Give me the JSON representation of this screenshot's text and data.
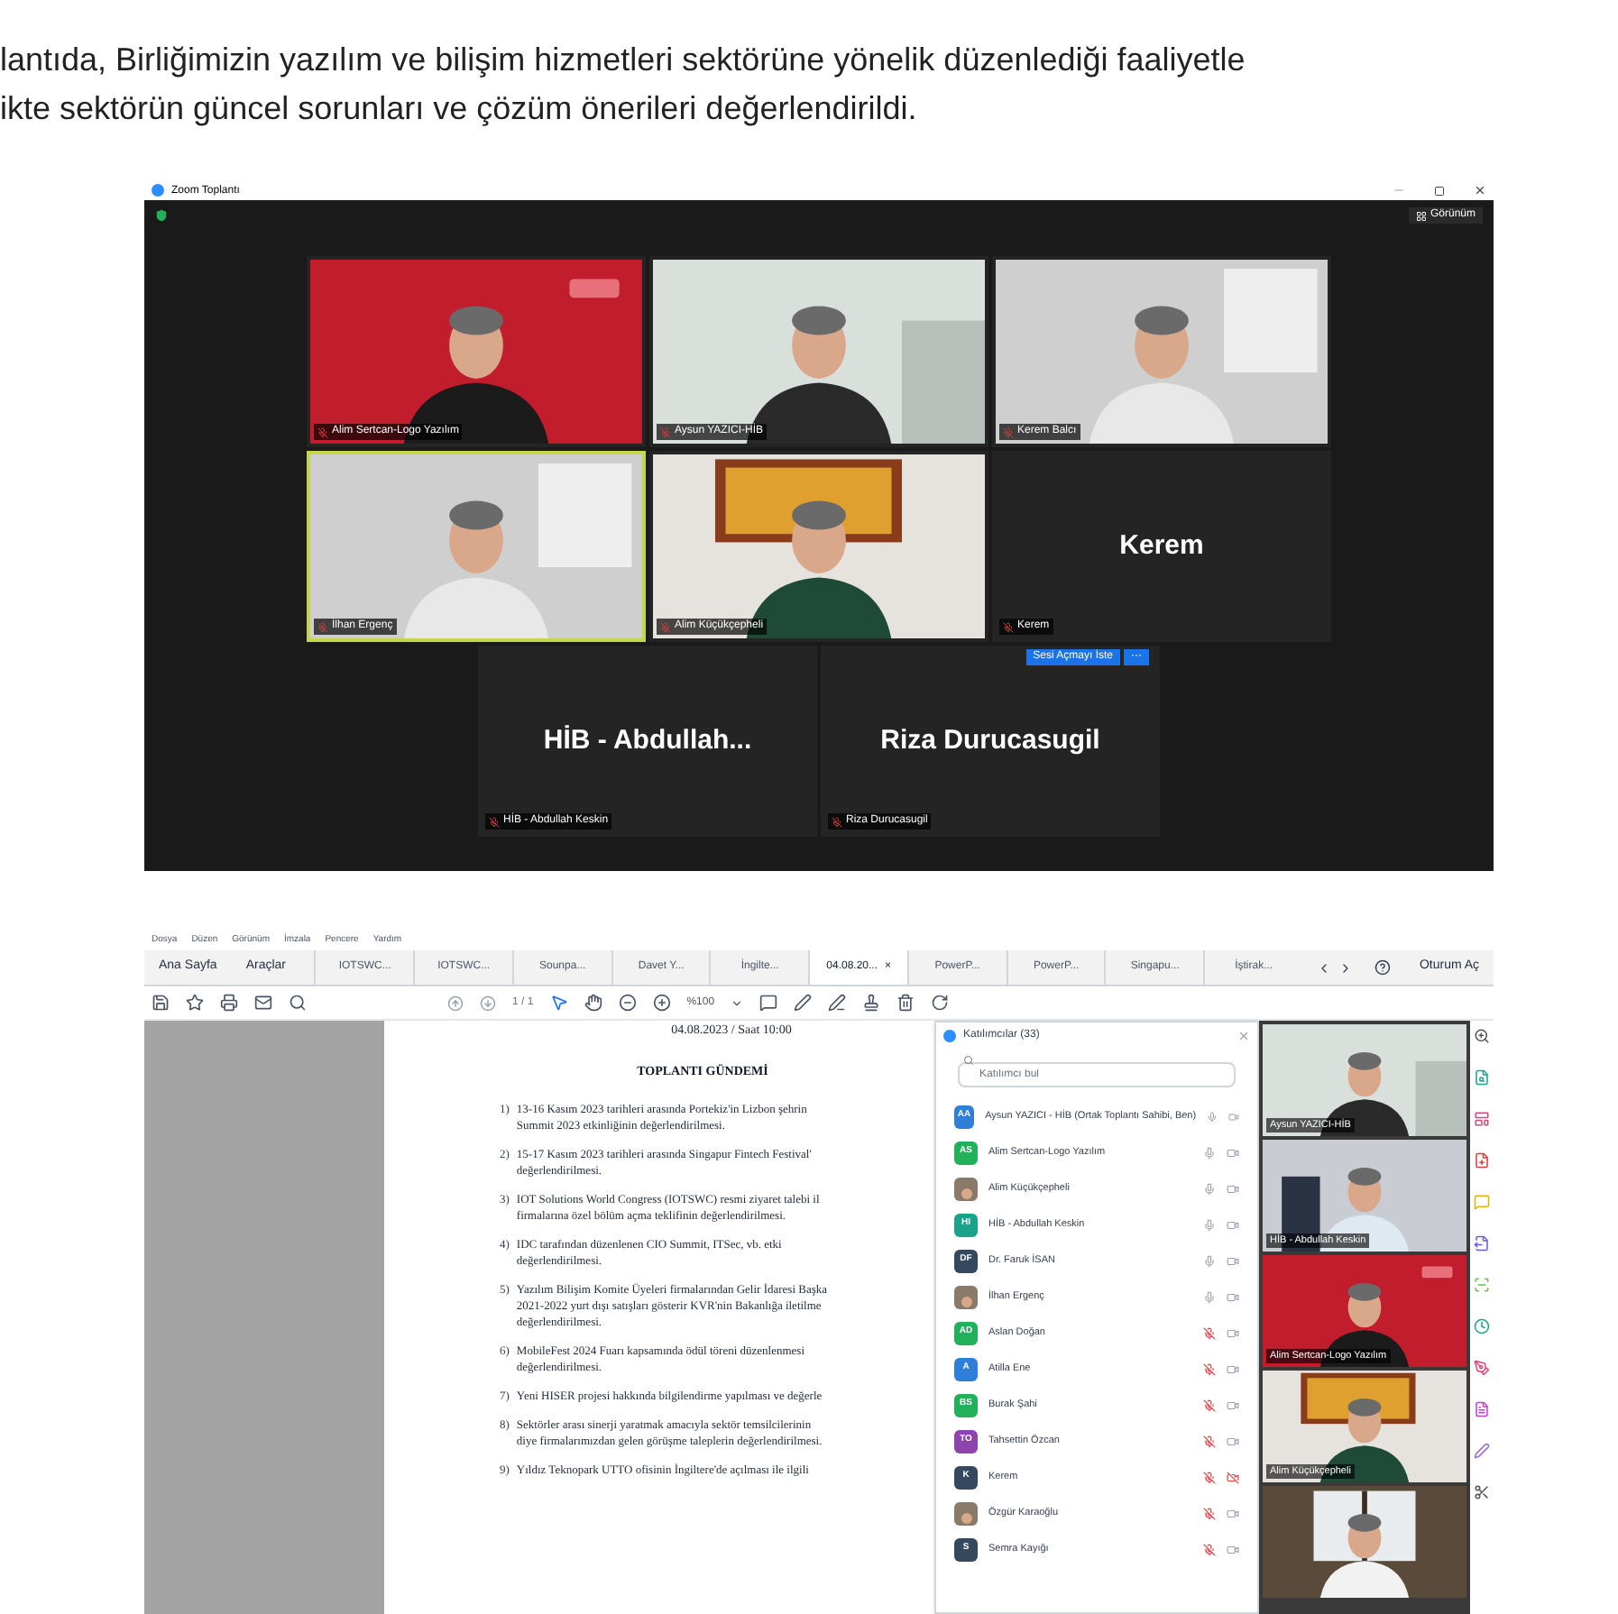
{
  "article": {
    "lines": [
      "lantıda, Birliğimizin yazılım ve bilişim hizmetleri sektörüne yönelik düzenlediği faaliyetle",
      "ikte sektörün güncel sorunları ve çözüm önerileri değerlendirildi."
    ]
  },
  "meeting": {
    "title": "Zoom Toplantı",
    "view_button": "Görünüm",
    "tiles": [
      {
        "kind": "video",
        "label": "Alim Sertcan-Logo Yazılım",
        "speaking": false
      },
      {
        "kind": "video",
        "label": "Aysun YAZICI-HİB",
        "speaking": false
      },
      {
        "kind": "video",
        "label": "Kerem Balcı",
        "speaking": false
      },
      {
        "kind": "video",
        "label": "İlhan Ergenç",
        "speaking": true
      },
      {
        "kind": "video",
        "label": "Alim Küçükçepheli",
        "speaking": false
      },
      {
        "kind": "name",
        "name": "Kerem",
        "label": "Kerem",
        "speaking": false
      },
      {
        "kind": "name",
        "name": "HİB - Abdullah...",
        "label": "HİB - Abdullah Keskin",
        "speaking": false
      },
      {
        "kind": "name",
        "name": "Riza Durucasugil",
        "label": "Riza Durucasugil",
        "speaking": false,
        "request_button": "Sesi Açmayı İste",
        "more_button": "···"
      }
    ]
  },
  "reader": {
    "menu": [
      "Dosya",
      "Düzen",
      "Görünüm",
      "İmzala",
      "Pencere",
      "Yardım"
    ],
    "nav": [
      "Ana Sayfa",
      "Araçlar"
    ],
    "tabs": [
      {
        "label": "IOTSWC...",
        "selected": false
      },
      {
        "label": "IOTSWC...",
        "selected": false
      },
      {
        "label": "Sounpa...",
        "selected": false
      },
      {
        "label": "Davet Y...",
        "selected": false
      },
      {
        "label": "İngilte...",
        "selected": false
      },
      {
        "label": "04.08.20...",
        "selected": true,
        "close": "×"
      },
      {
        "label": "PowerP...",
        "selected": false
      },
      {
        "label": "PowerP...",
        "selected": false
      },
      {
        "label": "Singapu...",
        "selected": false
      },
      {
        "label": "İştirak...",
        "selected": false
      }
    ],
    "sign_in": "Oturum Aç",
    "page_counter": "1 / 1",
    "zoom_level": "%100",
    "document": {
      "date": "04.08.2023 / Saat 10:00",
      "heading": "TOPLANTI GÜNDEMİ",
      "items": [
        {
          "number": "1)",
          "lines": [
            "13-16 Kasım 2023 tarihleri arasında Portekiz'in Lizbon şehrin",
            "Summit 2023 etkinliğinin değerlendirilmesi."
          ]
        },
        {
          "number": "2)",
          "lines": [
            "15-17 Kasım 2023 tarihleri arasında Singapur Fintech Festival'",
            "değerlendirilmesi."
          ]
        },
        {
          "number": "3)",
          "lines": [
            "IOT Solutions World Congress (IOTSWC) resmi ziyaret talebi il",
            "firmalarına özel bölüm açma teklifinin değerlendirilmesi."
          ]
        },
        {
          "number": "4)",
          "lines": [
            "IDC tarafından düzenlenen CIO Summit, ITSec, vb. etki",
            "değerlendirilmesi."
          ]
        },
        {
          "number": "5)",
          "lines": [
            "Yazılım Bilişim Komite Üyeleri firmalarından Gelir İdaresi Başka",
            "2021-2022 yurt dışı satışları gösterir KVR'nin Bakanlığa iletilme",
            "değerlendirilmesi."
          ]
        },
        {
          "number": "6)",
          "lines": [
            "MobileFest 2024 Fuarı kapsamında ödül töreni düzenlenmesi",
            "değerlendirilmesi."
          ]
        },
        {
          "number": "7)",
          "lines": [
            "Yeni HISER projesi hakkında bilgilendirme yapılması ve değerle"
          ]
        },
        {
          "number": "8)",
          "lines": [
            "Sektörler arası sinerji yaratmak amacıyla sektör temsilcilerinin",
            "diye firmalarımızdan gelen görüşme taleplerin değerlendirilmesi."
          ]
        },
        {
          "number": "9)",
          "lines": [
            "Yıldız Teknopark UTTO ofisinin İngiltere'de açılması ile ilgili"
          ]
        }
      ]
    },
    "participants": {
      "title": "Katılımcılar (33)",
      "search": {
        "placeholder": "Katılımcı bul"
      },
      "people": [
        {
          "kind": "initials",
          "initials": "AA",
          "color": "#2d7fd8",
          "name": "Aysun YAZICI - HİB (Ortak Toplantı Sahibi, Ben)",
          "muted": false,
          "video_off": false
        },
        {
          "kind": "initials",
          "initials": "AS",
          "color": "#23b05a",
          "name": "Alim Sertcan-Logo Yazılım",
          "muted": false,
          "video_off": false
        },
        {
          "name": "Alim Küçükçepheli",
          "muted": false,
          "video_off": false
        },
        {
          "kind": "initials",
          "initials": "HI",
          "color": "#1ba38a",
          "name": "HİB - Abdullah Keskin",
          "muted": false,
          "video_off": false
        },
        {
          "kind": "initials",
          "initials": "DF",
          "color": "#34495e",
          "name": "Dr. Faruk İSAN",
          "muted": false,
          "video_off": false
        },
        {
          "name": "İlhan Ergenç",
          "muted": false,
          "video_off": false
        },
        {
          "kind": "initials",
          "initials": "AD",
          "color": "#23b05a",
          "name": "Aslan Doğan",
          "muted": true,
          "video_off": false
        },
        {
          "kind": "initials",
          "initials": "A",
          "color": "#2d7fd8",
          "name": "Atilla Ene",
          "muted": true,
          "video_off": false
        },
        {
          "kind": "initials",
          "initials": "BS",
          "color": "#23b05a",
          "name": "Burak Şahi",
          "muted": true,
          "video_off": false
        },
        {
          "kind": "initials",
          "initials": "TO",
          "color": "#8e44ad",
          "name": "Tahsettin Özcan",
          "muted": true,
          "video_off": false
        },
        {
          "kind": "initials",
          "initials": "K",
          "color": "#34495e",
          "name": "Kerem",
          "muted": true,
          "video_off": true
        },
        {
          "name": "Özgür Karaoğlu",
          "muted": true,
          "video_off": false
        },
        {
          "kind": "initials",
          "initials": "S",
          "color": "#34495e",
          "name": "Semra Kayığı",
          "muted": true,
          "video_off": false
        }
      ]
    },
    "video_strip": [
      {
        "kind": "picture",
        "label": "Aysun YAZICI-HİB"
      },
      {
        "kind": "picture",
        "label": "HİB - Abdullah Keskin"
      },
      {
        "kind": "picture",
        "label": "Alim Sertcan-Logo Yazılım"
      },
      {
        "kind": "picture",
        "label": "Alim Küçükçepheli"
      },
      {
        "kind": "picture"
      }
    ]
  }
}
